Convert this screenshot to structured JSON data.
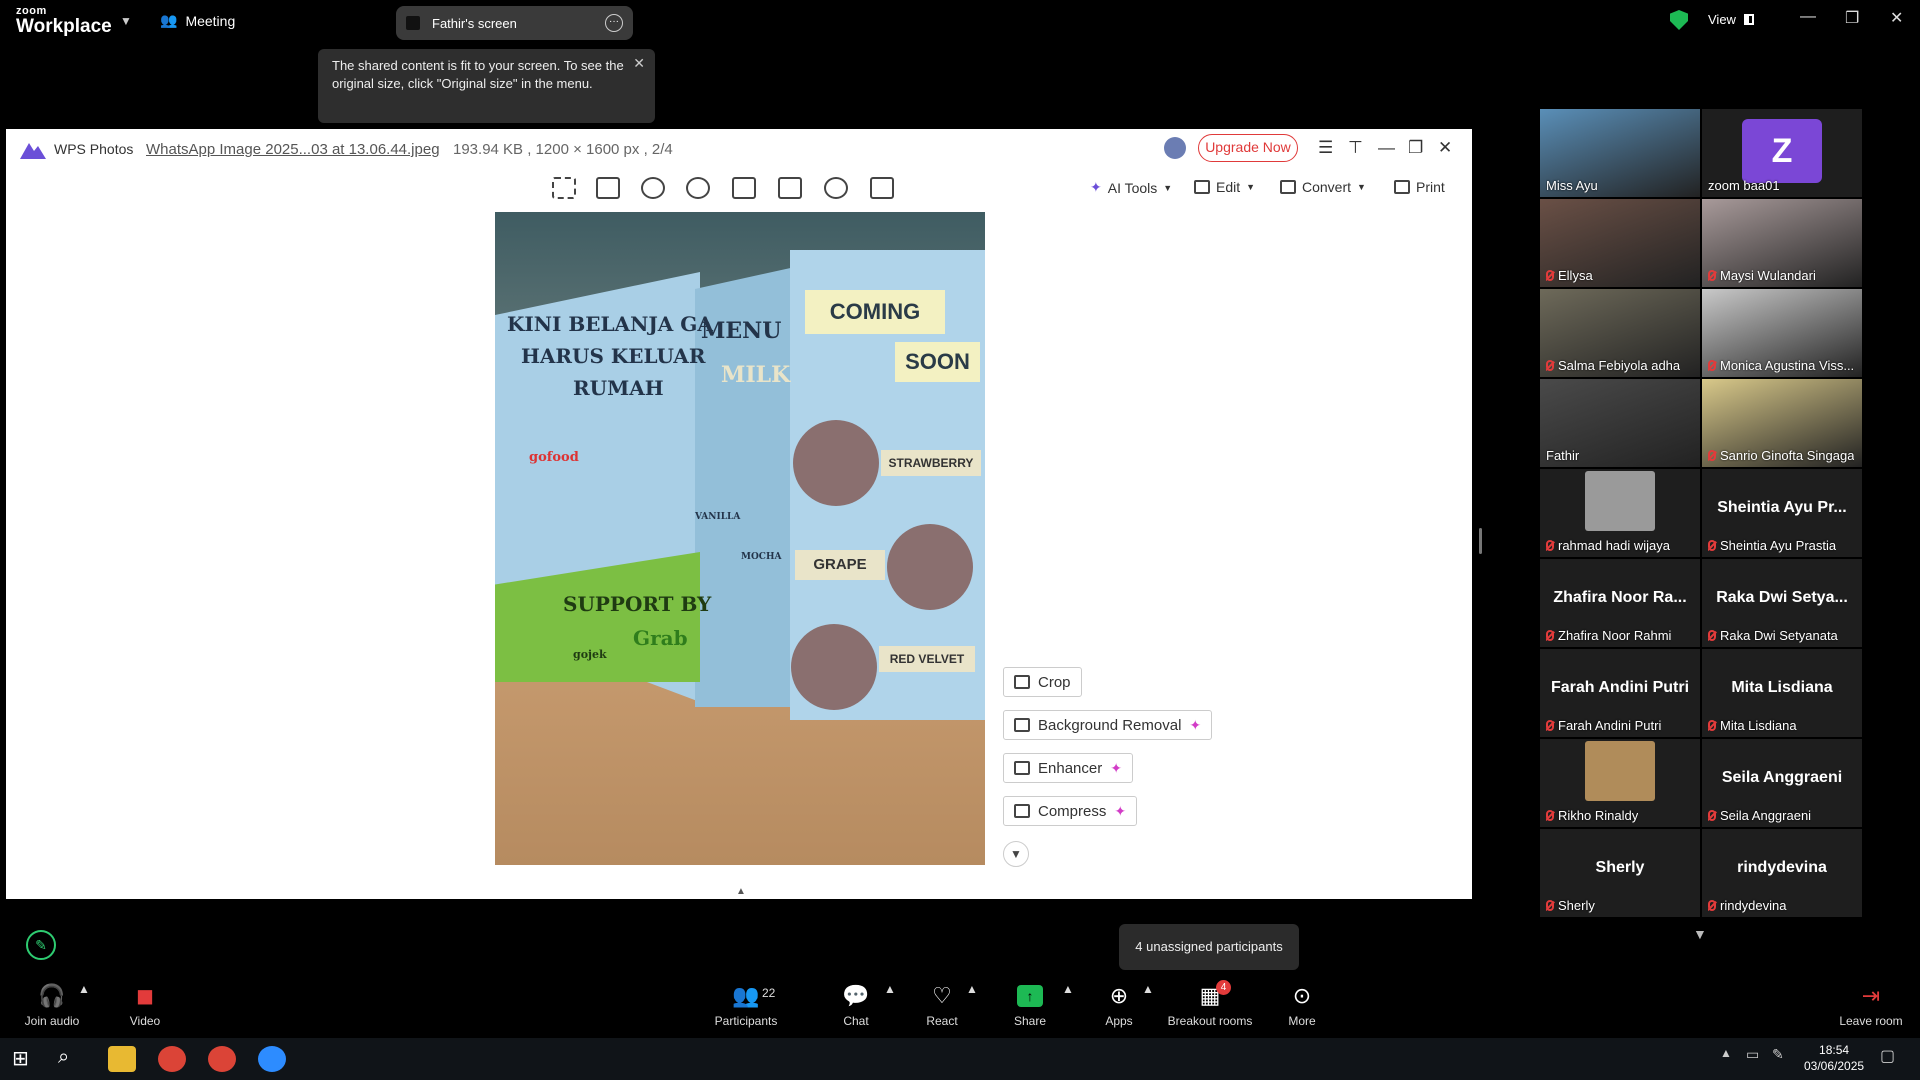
{
  "zoom": {
    "logo_top": "zoom",
    "logo_bottom": "Workplace",
    "meeting_label": "Meeting",
    "share_title": "Fathir's screen",
    "view_label": "View",
    "tooltip": "The shared content is fit to your screen. To see the original size, click \"Original size\" in the menu."
  },
  "wps": {
    "app_name": "WPS Photos",
    "file_name": "WhatsApp Image 2025...03 at 13.06.44.jpeg",
    "file_meta": "193.94 KB , 1200 × 1600 px , 2/4",
    "upgrade": "Upgrade Now",
    "ai_tools": "AI Tools",
    "edit": "Edit",
    "convert": "Convert",
    "print": "Print",
    "actions": {
      "crop": "Crop",
      "bg_removal": "Background Removal",
      "enhancer": "Enhancer",
      "compress": "Compress"
    }
  },
  "photo_text": {
    "left_1": "KINI BELANJA GA",
    "left_2": "HARUS KELUAR",
    "left_3": "RUMAH",
    "gofood": "gofood",
    "support": "SUPPORT BY",
    "gojek": "gojek",
    "grab": "Grab",
    "menu": "MENU",
    "milk": "MILK",
    "vanilla": "VANILLA",
    "mocha": "MOCHA",
    "coming": "COMING",
    "soon": "SOON",
    "strawberry": "STRAWBERRY",
    "grape": "GRAPE",
    "red_velvet": "RED VELVET"
  },
  "participants": [
    {
      "video_name": "Miss Ayu",
      "muted": false,
      "kind": "video",
      "color": "#5a8fb8"
    },
    {
      "video_name": "zoom baa01",
      "muted": false,
      "kind": "avatar",
      "letter": "Z"
    },
    {
      "video_name": "Ellysa",
      "muted": true,
      "kind": "video",
      "color": "#6a5046"
    },
    {
      "video_name": "Maysi Wulandari",
      "muted": true,
      "kind": "video",
      "color": "#a89a9a"
    },
    {
      "video_name": "Salma Febiyola adha",
      "muted": true,
      "kind": "video",
      "color": "#6e6a5a"
    },
    {
      "video_name": "Monica Agustina Viss...",
      "muted": true,
      "kind": "video",
      "color": "#c9c9c9"
    },
    {
      "video_name": "Fathir",
      "muted": false,
      "kind": "video",
      "color": "#4a4a4a",
      "active": true
    },
    {
      "video_name": "Sanrio Ginofta Singaga",
      "muted": true,
      "kind": "video",
      "color": "#d9c98a"
    },
    {
      "video_name": "rahmad hadi wijaya",
      "muted": true,
      "kind": "thumb",
      "color": "#9a9a9a"
    },
    {
      "big_name": "Sheintia Ayu Pr...",
      "video_name": "Sheintia Ayu Prastia",
      "muted": true,
      "kind": "name"
    },
    {
      "big_name": "Zhafira Noor Ra...",
      "video_name": "Zhafira Noor Rahmi",
      "muted": true,
      "kind": "name"
    },
    {
      "big_name": "Raka Dwi Setya...",
      "video_name": "Raka Dwi Setyanata",
      "muted": true,
      "kind": "name"
    },
    {
      "big_name": "Farah Andini Putri",
      "video_name": "Farah Andini Putri",
      "muted": true,
      "kind": "name"
    },
    {
      "big_name": "Mita Lisdiana",
      "video_name": "Mita Lisdiana",
      "muted": true,
      "kind": "name"
    },
    {
      "video_name": "Rikho Rinaldy",
      "muted": true,
      "kind": "thumb",
      "color": "#b08c5a"
    },
    {
      "big_name": "Seila Anggraeni",
      "video_name": "Seila Anggraeni",
      "muted": true,
      "kind": "name"
    },
    {
      "big_name": "Sherly",
      "video_name": "Sherly",
      "muted": true,
      "kind": "name"
    },
    {
      "big_name": "rindydevina",
      "video_name": "rindydevina",
      "muted": true,
      "kind": "name"
    }
  ],
  "unassigned": "4 unassigned participants",
  "toolbar": {
    "join_audio": "Join audio",
    "video": "Video",
    "participants": "Participants",
    "participants_count": "22",
    "chat": "Chat",
    "react": "React",
    "share": "Share",
    "apps": "Apps",
    "breakout": "Breakout rooms",
    "breakout_badge": "4",
    "more": "More",
    "leave": "Leave room"
  },
  "taskbar": {
    "time": "18:54",
    "date": "03/06/2025"
  }
}
